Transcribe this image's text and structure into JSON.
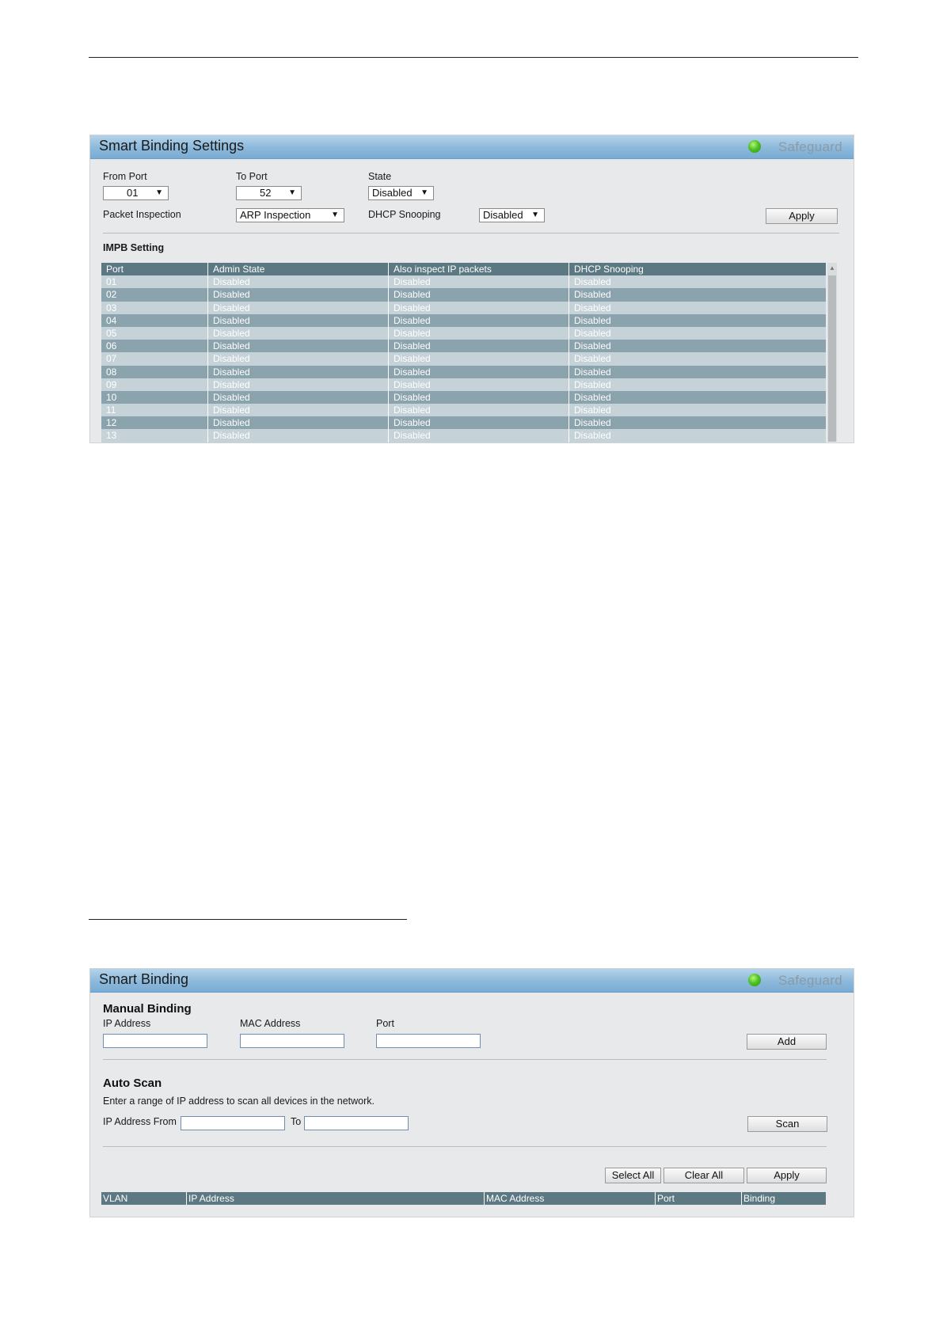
{
  "settings_panel": {
    "title": "Smart Binding Settings",
    "status": "Safeguard",
    "from_port": {
      "label": "From Port",
      "value": "01"
    },
    "to_port": {
      "label": "To Port",
      "value": "52"
    },
    "state": {
      "label": "State",
      "value": "Disabled"
    },
    "packet_inspection": {
      "label": "Packet Inspection",
      "value": "ARP Inspection"
    },
    "dhcp_snooping": {
      "label": "DHCP Snooping",
      "value": "Disabled"
    },
    "apply_label": "Apply",
    "section_title": "IMPB Setting",
    "table": {
      "columns": [
        "Port",
        "Admin State",
        "Also inspect IP packets",
        "DHCP Snooping"
      ],
      "rows": [
        [
          "01",
          "Disabled",
          "Disabled",
          "Disabled"
        ],
        [
          "02",
          "Disabled",
          "Disabled",
          "Disabled"
        ],
        [
          "03",
          "Disabled",
          "Disabled",
          "Disabled"
        ],
        [
          "04",
          "Disabled",
          "Disabled",
          "Disabled"
        ],
        [
          "05",
          "Disabled",
          "Disabled",
          "Disabled"
        ],
        [
          "06",
          "Disabled",
          "Disabled",
          "Disabled"
        ],
        [
          "07",
          "Disabled",
          "Disabled",
          "Disabled"
        ],
        [
          "08",
          "Disabled",
          "Disabled",
          "Disabled"
        ],
        [
          "09",
          "Disabled",
          "Disabled",
          "Disabled"
        ],
        [
          "10",
          "Disabled",
          "Disabled",
          "Disabled"
        ],
        [
          "11",
          "Disabled",
          "Disabled",
          "Disabled"
        ],
        [
          "12",
          "Disabled",
          "Disabled",
          "Disabled"
        ],
        [
          "13",
          "Disabled",
          "Disabled",
          "Disabled"
        ]
      ]
    }
  },
  "binding_panel": {
    "title": "Smart Binding",
    "status": "Safeguard",
    "manual": {
      "title": "Manual Binding",
      "ip_label": "IP Address",
      "mac_label": "MAC Address",
      "port_label": "Port",
      "ip_value": "",
      "mac_value": "",
      "port_value": "",
      "add_label": "Add"
    },
    "auto_scan": {
      "title": "Auto Scan",
      "description": "Enter a range of IP address to scan all devices in the network.",
      "from_label": "IP Address From",
      "to_label": "To",
      "from_value": "",
      "to_value": "",
      "scan_label": "Scan"
    },
    "select_all_label": "Select All",
    "clear_all_label": "Clear All",
    "apply_label": "Apply",
    "table": {
      "columns": [
        "VLAN",
        "IP Address",
        "MAC Address",
        "Port",
        "Binding"
      ]
    }
  }
}
